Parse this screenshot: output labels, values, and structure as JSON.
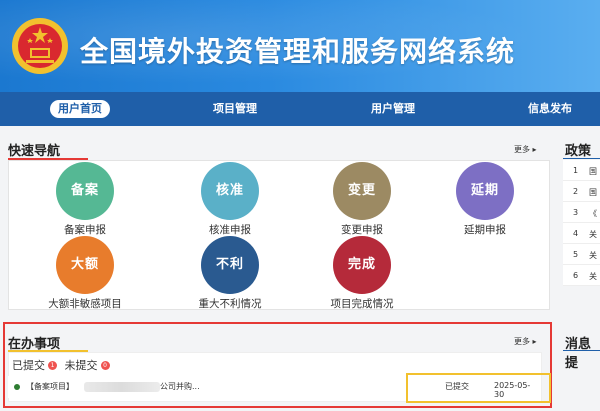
{
  "header": {
    "title": "全国境外投资管理和服务网络系统",
    "emblem_icon": "national-emblem-icon"
  },
  "nav": {
    "items": [
      {
        "label": "用户首页",
        "active": true
      },
      {
        "label": "项目管理",
        "active": false
      },
      {
        "label": "用户管理",
        "active": false
      },
      {
        "label": "信息发布",
        "active": false
      }
    ]
  },
  "quick_nav": {
    "title": "快速导航",
    "more": "更多",
    "tiles": [
      {
        "glyph": "备案",
        "label": "备案申报",
        "color": "#55b894"
      },
      {
        "glyph": "核准",
        "label": "核准申报",
        "color": "#5ab0c8"
      },
      {
        "glyph": "变更",
        "label": "变更申报",
        "color": "#9c8a63"
      },
      {
        "glyph": "延期",
        "label": "延期申报",
        "color": "#7d6fc4"
      },
      {
        "glyph": "大额",
        "label": "大额非敏感项目",
        "color": "#e87c2c"
      },
      {
        "glyph": "不利",
        "label": "重大不利情况",
        "color": "#2a5a90"
      },
      {
        "glyph": "完成",
        "label": "项目完成情况",
        "color": "#b52a3a"
      }
    ]
  },
  "policy": {
    "title": "政策法",
    "rows": [
      {
        "num": "1",
        "text": "国"
      },
      {
        "num": "2",
        "text": "国"
      },
      {
        "num": "3",
        "text": "《"
      },
      {
        "num": "4",
        "text": "关"
      },
      {
        "num": "5",
        "text": "关"
      },
      {
        "num": "6",
        "text": "关"
      }
    ]
  },
  "todo": {
    "title": "在办事项",
    "more": "更多",
    "tab_submitted": "已提交",
    "tab_submitted_count": "1",
    "tab_unsubmitted": "未提交",
    "tab_unsubmitted_count": "0",
    "row": {
      "tag": "【备案项目】",
      "name_suffix": "公司并购...",
      "status": "已提交",
      "date": "2025-05-30"
    }
  },
  "messages": {
    "title": "消息提"
  },
  "colors": {
    "accent_red": "#e53935",
    "nav_blue": "#1f5fa9"
  }
}
